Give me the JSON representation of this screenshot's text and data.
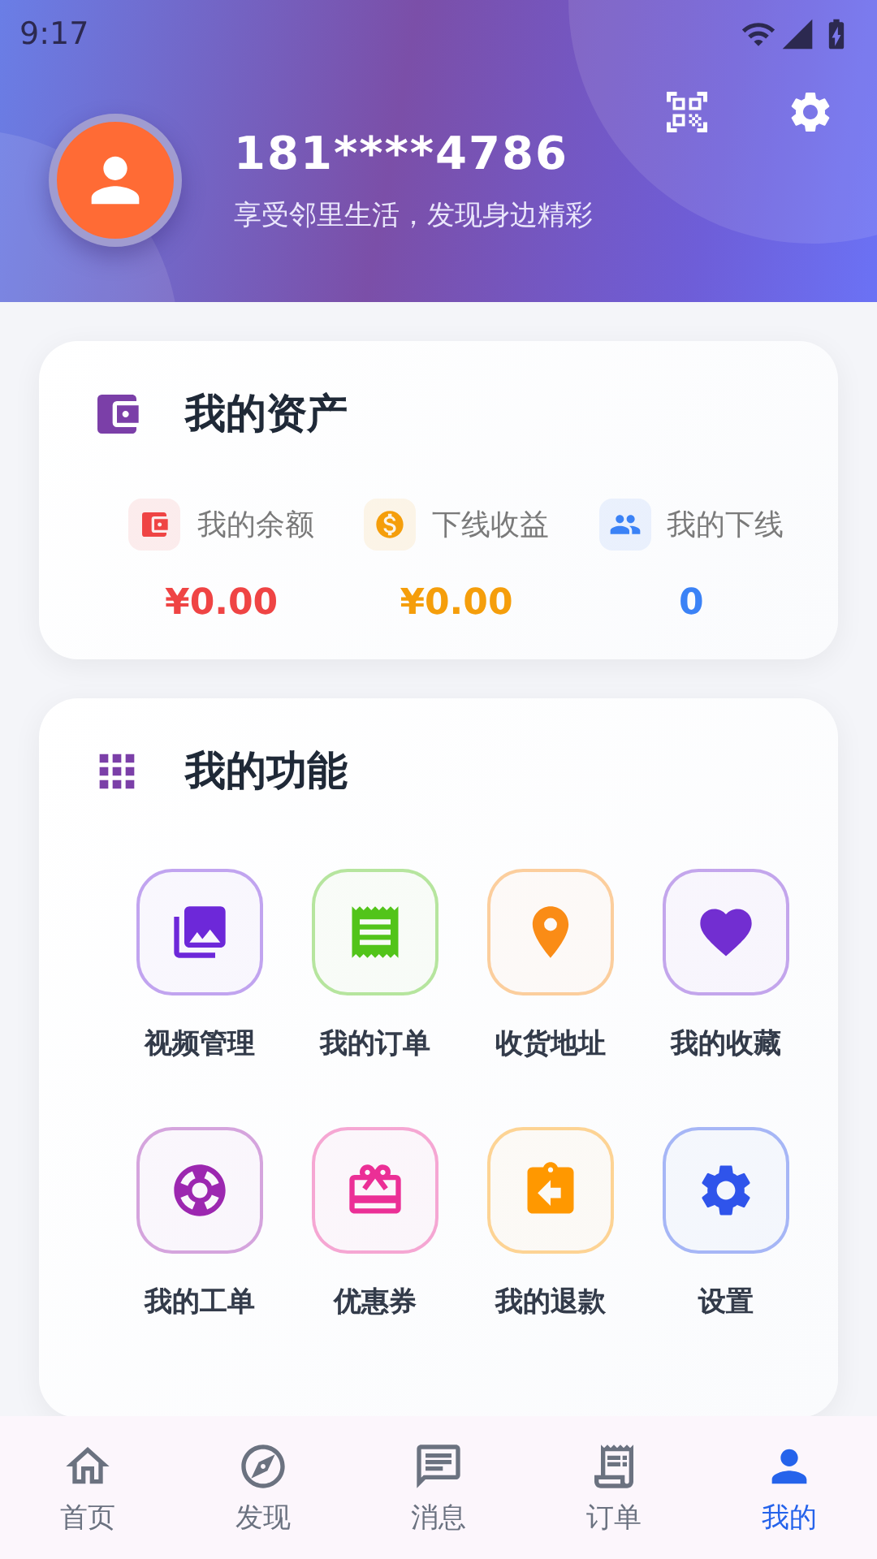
{
  "status_bar": {
    "time": "9:17"
  },
  "profile": {
    "phone": "181****4786",
    "slogan": "享受邻里生活，发现身边精彩"
  },
  "assets": {
    "title": "我的资产",
    "items": [
      {
        "label": "我的余额",
        "value": "¥0.00",
        "color": "#ef4444"
      },
      {
        "label": "下线收益",
        "value": "¥0.00",
        "color": "#f59e0b"
      },
      {
        "label": "我的下线",
        "value": "0",
        "color": "#3b82f6"
      }
    ]
  },
  "functions": {
    "title": "我的功能",
    "items": [
      {
        "label": "视频管理",
        "color": "#6d28d9"
      },
      {
        "label": "我的订单",
        "color": "#52c41a"
      },
      {
        "label": "收货地址",
        "color": "#fa8c16"
      },
      {
        "label": "我的收藏",
        "color": "#722ed1"
      },
      {
        "label": "我的工单",
        "color": "#9c27b0"
      },
      {
        "label": "优惠券",
        "color": "#eb2f96"
      },
      {
        "label": "我的退款",
        "color": "#ff9800"
      },
      {
        "label": "设置",
        "color": "#2f54eb"
      }
    ]
  },
  "bottom_nav": [
    {
      "label": "首页",
      "selected": false
    },
    {
      "label": "发现",
      "selected": false
    },
    {
      "label": "消息",
      "selected": false
    },
    {
      "label": "订单",
      "selected": false
    },
    {
      "label": "我的",
      "selected": true
    }
  ]
}
